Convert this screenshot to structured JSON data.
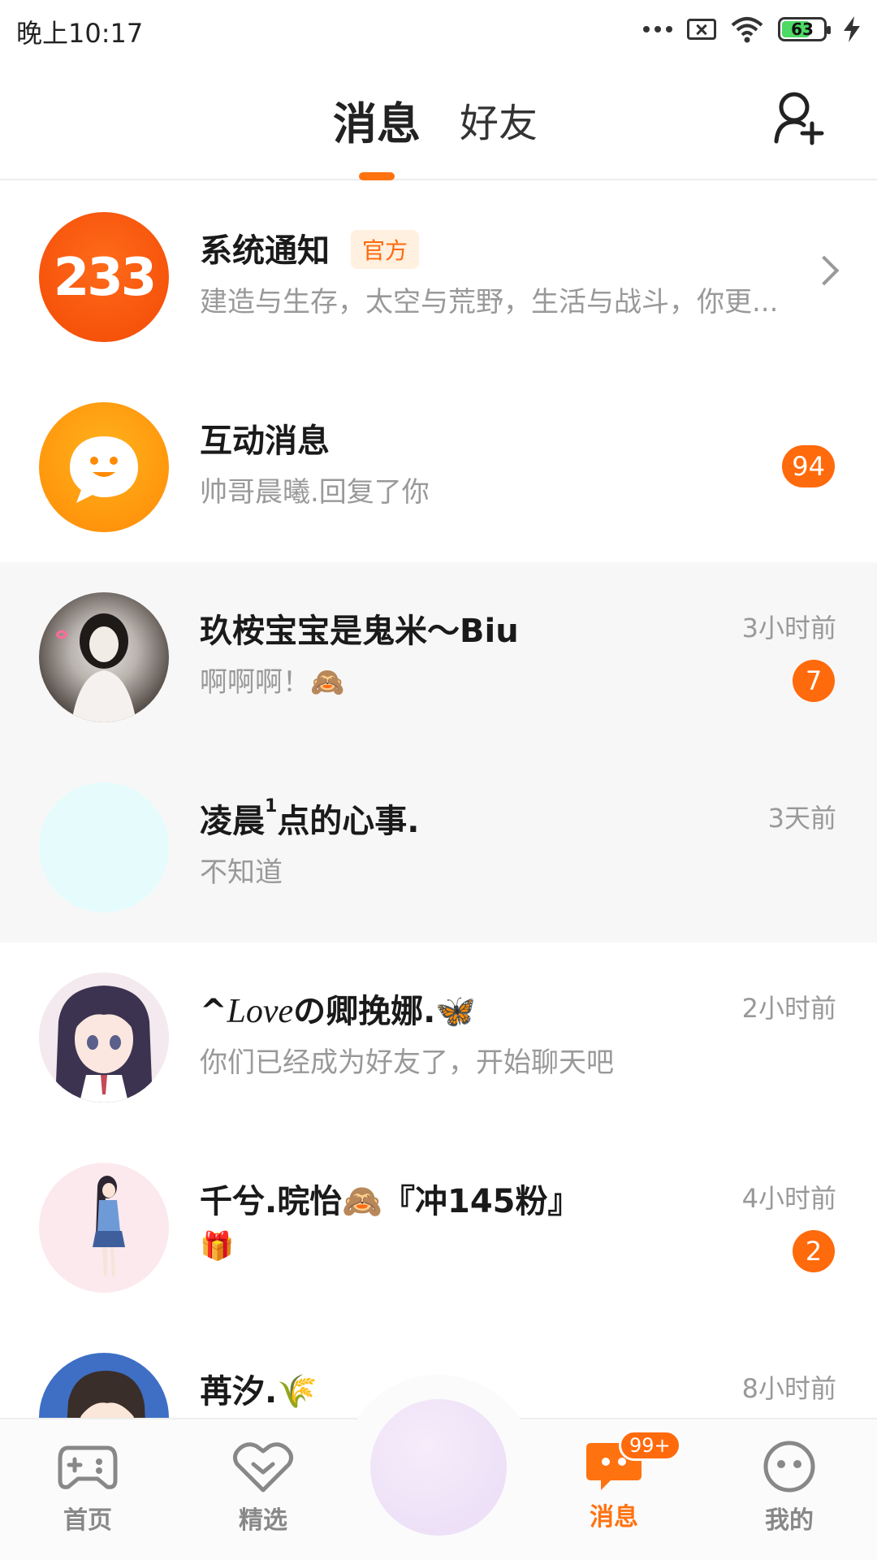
{
  "status_bar": {
    "time": "晚上10:17",
    "battery": "63"
  },
  "header": {
    "tabs": [
      {
        "label": "消息",
        "active": true
      },
      {
        "label": "好友",
        "active": false
      }
    ],
    "add_friend_icon": "add-user-icon"
  },
  "conversations": [
    {
      "name": "系统通知",
      "tag": "官方",
      "preview": "建造与生存，太空与荒野，生活与战斗，你更...",
      "time": "",
      "badge": "",
      "avatar_text": "233",
      "pinned": false
    },
    {
      "name": "互动消息",
      "preview": "帅哥晨曦.回复了你",
      "time": "",
      "badge": "94",
      "pinned": false
    },
    {
      "name": "玖桉宝宝是鬼米～Biu",
      "preview": "啊啊啊！🙈",
      "time": "3小时前",
      "badge": "7",
      "pinned": true
    },
    {
      "name_prefix": "凌晨",
      "name_sup": "1",
      "name_suffix": "点的心事.",
      "preview": "不知道",
      "time": "3天前",
      "badge": "",
      "pinned": true
    },
    {
      "name_prefix": "^",
      "name_italic": "Love",
      "name_suffix": "の卿挽娜.🦋",
      "preview": "你们已经成为好友了，开始聊天吧",
      "time": "2小时前",
      "badge": "",
      "pinned": false
    },
    {
      "name": "千兮.晥怡🙈『冲145粉』",
      "preview": "🎁",
      "time": "4小时前",
      "badge": "2",
      "pinned": false
    },
    {
      "name": "苒汐.🌾",
      "preview": "",
      "time": "8小时前",
      "badge": "",
      "pinned": false
    }
  ],
  "bottom_nav": [
    {
      "label": "首页",
      "icon": "gamepad-icon",
      "active": false
    },
    {
      "label": "精选",
      "icon": "heart-icon",
      "active": false
    },
    {
      "label": "消息",
      "icon": "message-icon",
      "active": true,
      "badge": "99+"
    },
    {
      "label": "我的",
      "icon": "face-icon",
      "active": false
    }
  ],
  "colors": {
    "accent": "#ff7210",
    "badge": "#ff6a0c"
  }
}
